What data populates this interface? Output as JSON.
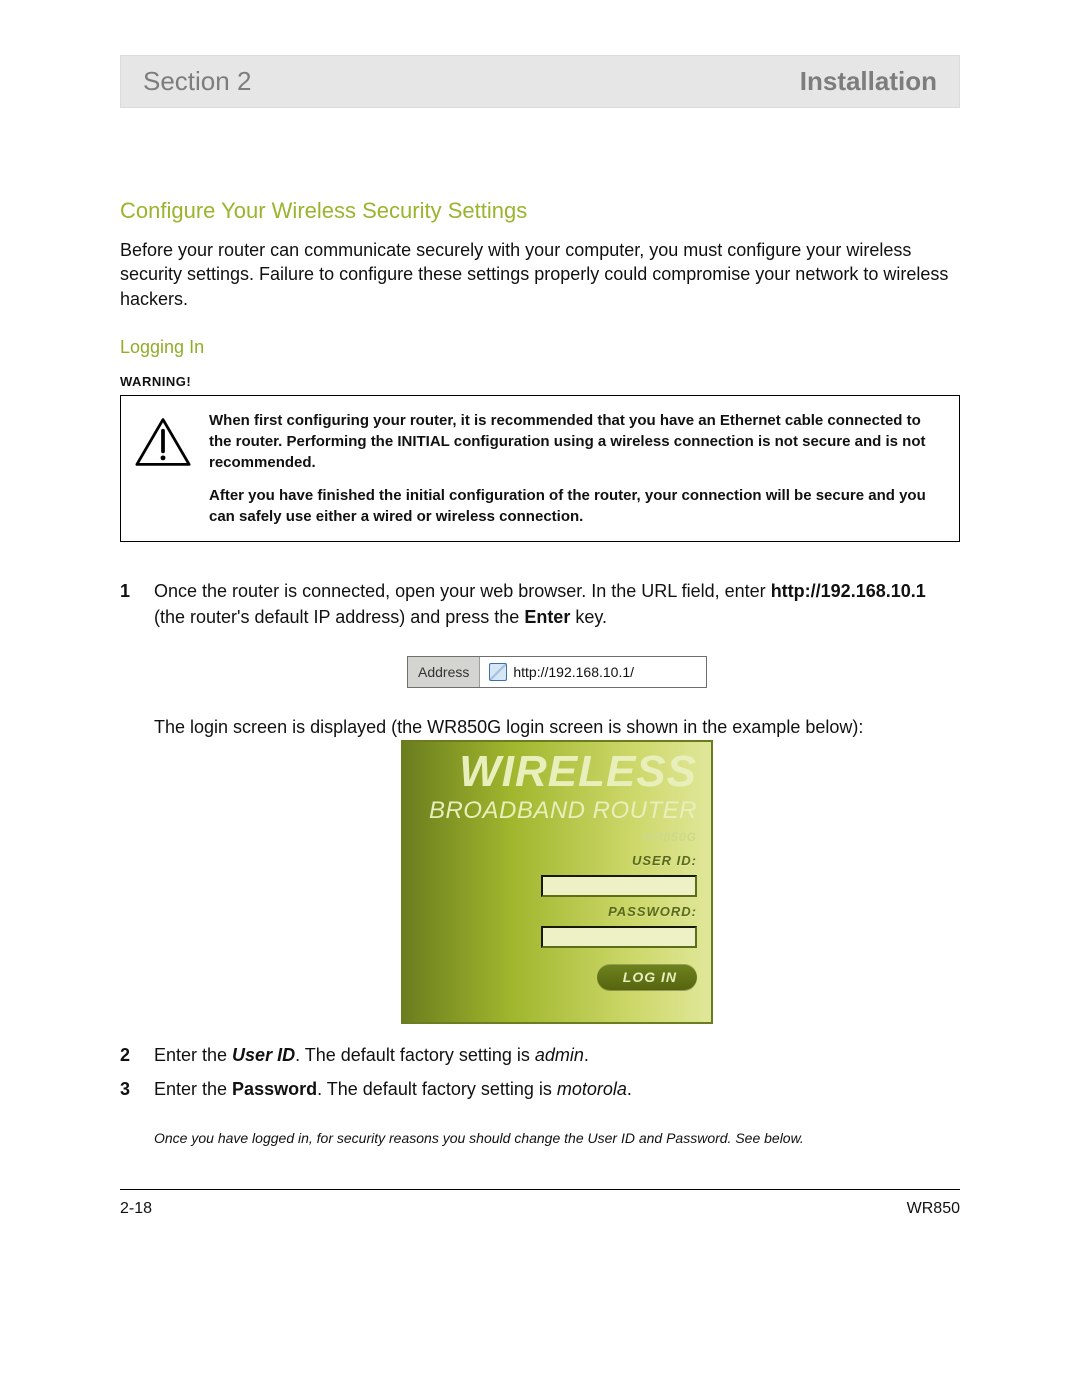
{
  "banner": {
    "left": "Section 2",
    "right": "Installation"
  },
  "heading_main": "Configure Your Wireless Security Settings",
  "intro": "Before your router can communicate securely with your computer, you must configure your wireless security settings. Failure to configure these settings properly could compromise your network to wireless hackers.",
  "heading_sub": "Logging In",
  "warning_label": "WARNING!",
  "warning_para1": "When first configuring your router, it is recommended that you have an Ethernet cable connected to the router. Performing the INITIAL configuration using a wireless connection is not secure and is not recommended.",
  "warning_para2": "After you have finished the initial configuration of the router, your connection will be secure and you can safely use either a wired or wireless connection.",
  "step1": {
    "num": "1",
    "line1_a": "Once the router is connected, open your web browser. In the URL field, enter ",
    "url_bold": "http://192.168.10.1",
    "line1_b": " (the router's default IP address) and press the ",
    "enter_bold": "Enter",
    "line1_c": " key.",
    "address_label": "Address",
    "address_value": "http://192.168.10.1/",
    "line2": "The login screen is displayed (the WR850G login screen is shown in the example below):"
  },
  "login_panel": {
    "title1": "WIRELESS",
    "title2": "BROADBAND ROUTER",
    "model": "WR850G",
    "userid_label": "USER ID:",
    "password_label": "PASSWORD:",
    "button": "LOG IN"
  },
  "step2": {
    "num": "2",
    "a": "Enter the ",
    "b_bold_i": "User ID",
    "c": ". The default factory setting is ",
    "d_i": "admin",
    "e": "."
  },
  "step3": {
    "num": "3",
    "a": "Enter the ",
    "b_bold": "Password",
    "c": ". The default factory setting is ",
    "d_i": "motorola",
    "e": "."
  },
  "note": "Once you have logged in, for security reasons you should change the User ID and Password. See below.",
  "footer": {
    "left": "2-18",
    "right": "WR850"
  }
}
